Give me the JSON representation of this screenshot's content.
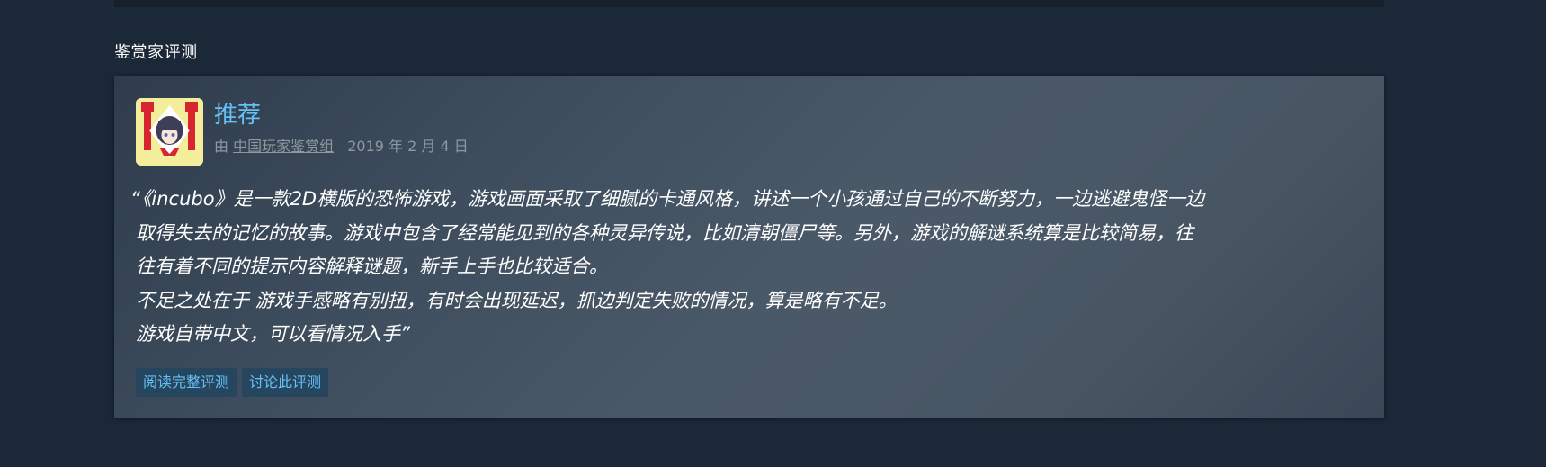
{
  "section": {
    "title": "鉴赏家评测"
  },
  "review": {
    "recommendation": "推荐",
    "by_prefix": "由",
    "curator_name": "中国玩家鉴赏组",
    "date": "2019 年 2 月 4 日",
    "open_quote": "“",
    "quote_lines": [
      "《incubo》是一款2D横版的恐怖游戏，游戏画面采取了细腻的卡通风格，讲述一个小孩通过自己的不断努力，一边逃避鬼怪一边",
      "取得失去的记忆的故事。游戏中包含了经常能见到的各种灵异传说，比如清朝僵尸等。另外，游戏的解谜系统算是比较简易，往",
      "往有着不同的提示内容解释谜题，新手上手也比较适合。",
      "不足之处在于 游戏手感略有别扭，有时会出现延迟，抓边判定失败的情况，算是略有不足。",
      "游戏自带中文，可以看情况入手"
    ],
    "close_quote": "”",
    "read_full_label": "阅读完整评测",
    "discuss_label": "讨论此评测"
  },
  "colors": {
    "page_bg": "#1b2838",
    "accent_blue": "#66c0f4",
    "muted_text": "#8f98a0",
    "button_bg": "#26465f"
  },
  "icons": {
    "avatar": "curator-avatar-icon"
  }
}
